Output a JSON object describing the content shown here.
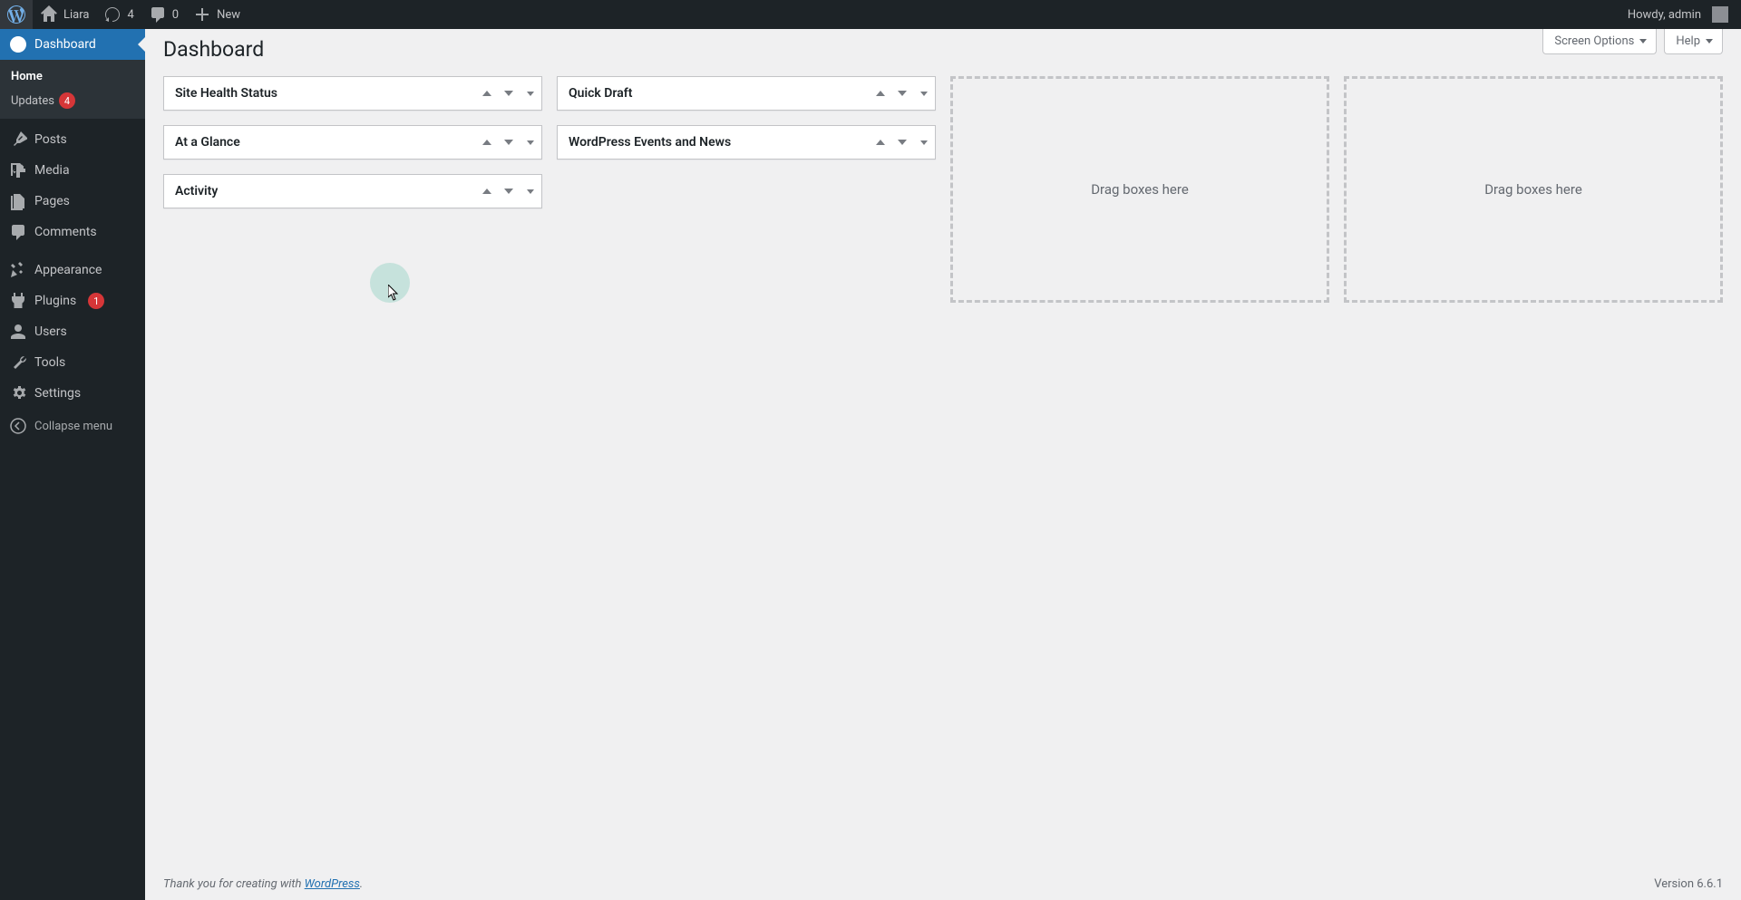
{
  "adminBar": {
    "siteName": "Liara",
    "updatesCount": "4",
    "commentsCount": "0",
    "newLabel": "New",
    "howdy": "Howdy, admin"
  },
  "sidebar": {
    "items": [
      {
        "label": "Dashboard",
        "icon": "dashboard",
        "current": true
      },
      {
        "label": "Posts",
        "icon": "pin"
      },
      {
        "label": "Media",
        "icon": "media"
      },
      {
        "label": "Pages",
        "icon": "pages"
      },
      {
        "label": "Comments",
        "icon": "comments"
      },
      {
        "label": "Appearance",
        "icon": "appearance"
      },
      {
        "label": "Plugins",
        "icon": "plugins",
        "badge": "1"
      },
      {
        "label": "Users",
        "icon": "users"
      },
      {
        "label": "Tools",
        "icon": "tools"
      },
      {
        "label": "Settings",
        "icon": "settings"
      }
    ],
    "submenu": {
      "home": "Home",
      "updates": "Updates",
      "updatesBadge": "4"
    },
    "collapse": "Collapse menu"
  },
  "screenMeta": {
    "screenOptions": "Screen Options",
    "help": "Help"
  },
  "pageTitle": "Dashboard",
  "postboxes": {
    "col1": [
      {
        "title": "Site Health Status"
      },
      {
        "title": "At a Glance"
      },
      {
        "title": "Activity"
      }
    ],
    "col2": [
      {
        "title": "Quick Draft"
      },
      {
        "title": "WordPress Events and News"
      }
    ],
    "emptyText": "Drag boxes here"
  },
  "footer": {
    "text": "Thank you for creating with ",
    "link": "WordPress",
    "period": ".",
    "version": "Version 6.6.1"
  }
}
